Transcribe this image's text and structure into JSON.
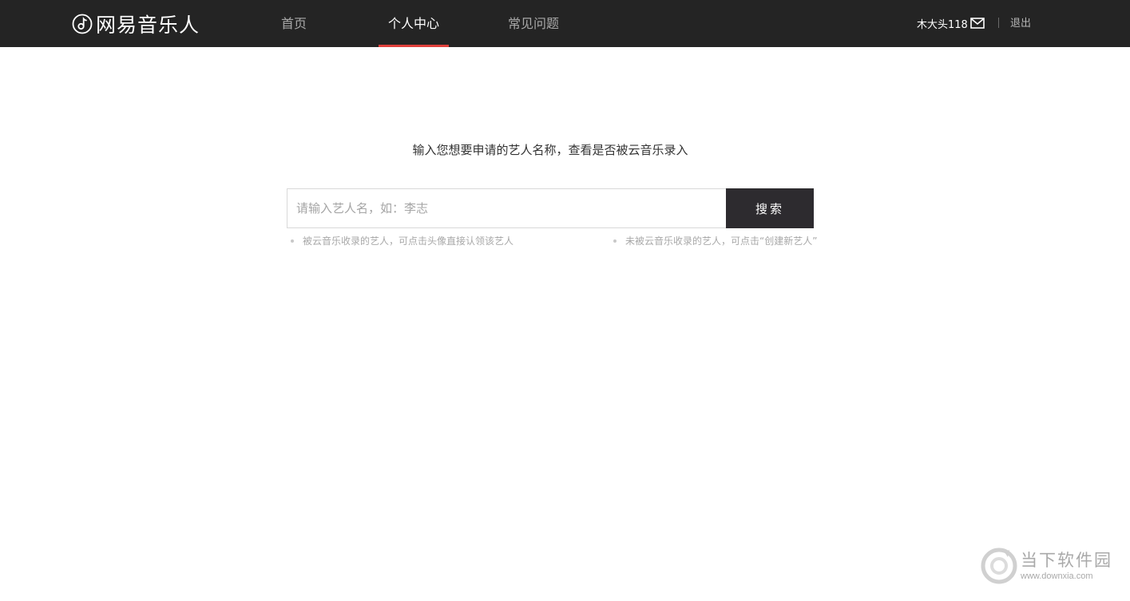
{
  "header": {
    "logo_text": "网易音乐人",
    "nav": [
      {
        "label": "首页",
        "active": false
      },
      {
        "label": "个人中心",
        "active": true
      },
      {
        "label": "常见问题",
        "active": false
      }
    ],
    "username": "木大头118",
    "mail_icon": "mail-icon",
    "logout_label": "退出",
    "accent_color": "#e0403b",
    "bg_color": "#242424"
  },
  "main": {
    "prompt": "输入您想要申请的艺人名称，查看是否被云音乐录入",
    "search": {
      "placeholder": "请输入艺人名，如：李志",
      "value": "",
      "button_label": "搜索"
    },
    "hints": [
      "被云音乐收录的艺人，可点击头像直接认领该艺人",
      "未被云音乐收录的艺人，可点击“创建新艺人”"
    ]
  },
  "watermark": {
    "title": "当下软件园",
    "url": "www.downxia.com"
  }
}
